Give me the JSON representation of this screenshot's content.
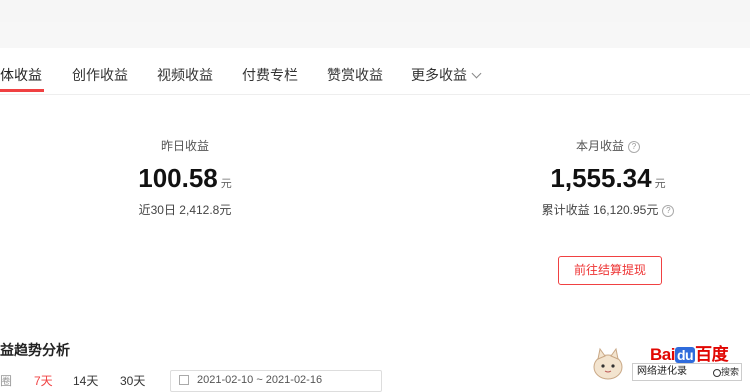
{
  "tabs": [
    {
      "label": "体收益",
      "active": true
    },
    {
      "label": "创作收益",
      "active": false
    },
    {
      "label": "视频收益",
      "active": false
    },
    {
      "label": "付费专栏",
      "active": false
    },
    {
      "label": "赞赏收益",
      "active": false
    },
    {
      "label": "更多收益",
      "active": false
    }
  ],
  "yesterday": {
    "label": "昨日收益",
    "amount": "100.58",
    "unit": "元",
    "sub": "近30日 2,412.8元"
  },
  "month": {
    "label": "本月收益",
    "amount": "1,555.34",
    "unit": "元",
    "sub": "累计收益 16,120.95元",
    "help_icon": "question-circle-icon"
  },
  "withdraw_button": "前往结算提现",
  "trend": {
    "title": "益趋势分析",
    "ranges": [
      "圈",
      "7天",
      "14天",
      "30天"
    ],
    "date_range": "2021-02-10  ~  2021-02-16"
  },
  "watermark": {
    "brand_left": "Bai",
    "brand_du": "du",
    "brand_right": "百度",
    "caption": "网络进化录",
    "search_label": "搜索"
  },
  "colors": {
    "accent": "#f04142",
    "text": "#222222"
  }
}
